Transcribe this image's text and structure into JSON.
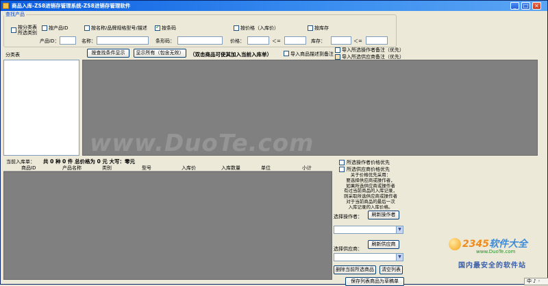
{
  "window": {
    "title": "商品入库-ZS8进销存管理系统-ZS8进销存管理软件",
    "minimize_glyph": "_",
    "maximize_glyph": "□",
    "close_glyph": "×"
  },
  "filter": {
    "group_title": "查找产品",
    "by_category_line1": "按分类表",
    "by_category_line2": "所选类别",
    "by_product_id": "按产品ID",
    "by_name": "按名称/品牌规格型号/描述",
    "by_barcode": "按条码",
    "by_price": "按价格（入库价）",
    "by_stock": "按库存",
    "product_id_label": "产品ID：",
    "name_label": "名称：",
    "barcode_label": "条形码：",
    "price_label": "价格：",
    "gte_label": "＞=",
    "lte_label": "＜=",
    "stock_label": "库存：",
    "barcode_checked": true
  },
  "toolbar": {
    "category_tree_label": "分类表",
    "search_button": "按查找条件显示",
    "show_all_button": "显示所有（包含无效）",
    "hint": "（双击商品可使其加入当前入库单）",
    "import_desc_to_note": "导入商品描述到备注",
    "import_operator_note": "导入所选操作者备注（优先）",
    "import_supplier_note": "导入所选供应商备注（优先）"
  },
  "order": {
    "summary_label": "当前入库单：",
    "summary_values": "共 0 种   0 件  总价格为 0 元   大写：零元",
    "columns": [
      "商品ID",
      "产品名称",
      "类别",
      "型号",
      "入库价",
      "入库数量",
      "单位",
      "小计"
    ]
  },
  "right_panel": {
    "operator_price_priority": "所选操作者价格优先",
    "supplier_price_priority": "所选供应商价格优先",
    "note_lines": [
      "关于价格优先采用：",
      "要选择供应商或操作者，",
      "如果所选供应商或操作者",
      "有过当前商品的入库记录，",
      "则采取所选供应商或操作者",
      "对于当前商品的最后一次",
      "入库记录的入库价格。"
    ],
    "select_operator_label": "选择操作者：",
    "refresh_operator_button": "刷新操作者",
    "select_supplier_label": "选择供应商：",
    "refresh_supplier_button": "刷新供应商",
    "delete_selected_button": "删除当前所选商品",
    "clear_list_button": "清空列表",
    "save_button": "保存列表商品为草稿单"
  },
  "watermark": {
    "main": "www.DuoTe.com",
    "brand_a": "2345",
    "brand_b": "软件大全",
    "url": "www.DuoTe.com",
    "slogan": "国内最安全的软件站"
  },
  "tray": {
    "ime": "中 ♪ ◦"
  }
}
